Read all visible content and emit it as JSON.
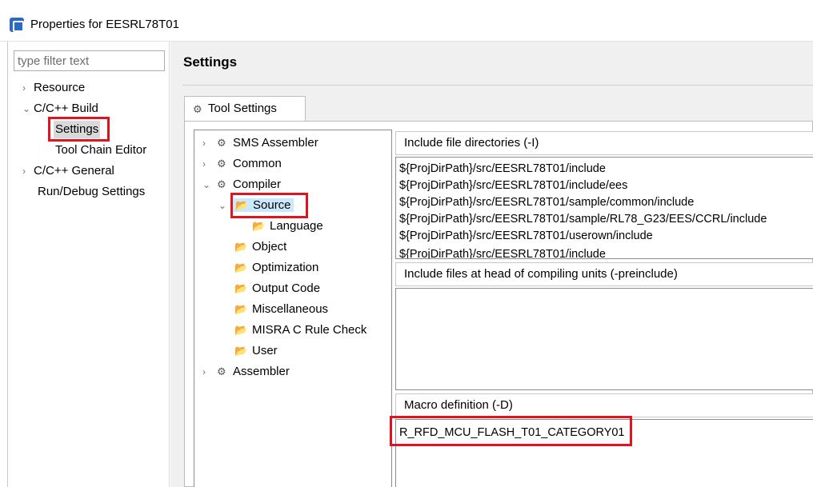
{
  "window": {
    "title": "Properties for EESRL78T01"
  },
  "filter": {
    "placeholder": "type filter text"
  },
  "nav_tree": [
    {
      "label": "Resource",
      "expander": "›"
    },
    {
      "label": "C/C++ Build",
      "expander": "⌄"
    },
    {
      "label": "Settings",
      "selected": true
    },
    {
      "label": "Tool Chain Editor"
    },
    {
      "label": "C/C++ General",
      "expander": "›"
    },
    {
      "label": "Run/Debug Settings"
    }
  ],
  "header": {
    "title": "Settings"
  },
  "tab": {
    "label": "Tool Settings",
    "icon": "gear-icon"
  },
  "tool_tree": [
    {
      "label": "SMS Assembler",
      "icon": "gear-icon",
      "expander": "›"
    },
    {
      "label": "Common",
      "icon": "gear-icon",
      "expander": "›"
    },
    {
      "label": "Compiler",
      "icon": "gear-icon",
      "expander": "⌄"
    },
    {
      "label": "Source",
      "icon": "folder-icon",
      "expander": "⌄",
      "selected": true
    },
    {
      "label": "Language",
      "icon": "folder-icon"
    },
    {
      "label": "Object",
      "icon": "folder-icon"
    },
    {
      "label": "Optimization",
      "icon": "folder-icon"
    },
    {
      "label": "Output Code",
      "icon": "folder-icon"
    },
    {
      "label": "Miscellaneous",
      "icon": "folder-icon"
    },
    {
      "label": "MISRA C Rule Check",
      "icon": "folder-icon"
    },
    {
      "label": "User",
      "icon": "folder-icon"
    },
    {
      "label": "Assembler",
      "icon": "gear-icon",
      "expander": "›"
    }
  ],
  "include_dirs": {
    "label": "Include file directories (-I)",
    "items": [
      "${ProjDirPath}/src/EESRL78T01/include",
      "${ProjDirPath}/src/EESRL78T01/include/ees",
      "${ProjDirPath}/src/EESRL78T01/sample/common/include",
      "${ProjDirPath}/src/EESRL78T01/sample/RL78_G23/EES/CCRL/include",
      "${ProjDirPath}/src/EESRL78T01/userown/include",
      "${ProjDirPath}/src/EESRL78T01/include"
    ]
  },
  "preinclude": {
    "label": "Include files at head of compiling units (-preinclude)",
    "items": []
  },
  "macro": {
    "label": "Macro definition (-D)",
    "items": [
      "R_RFD_MCU_FLASH_T01_CATEGORY01"
    ]
  },
  "colors": {
    "highlight_box": "#e0141e",
    "selection": "#cce8ff",
    "background": "#f0f0f0"
  }
}
